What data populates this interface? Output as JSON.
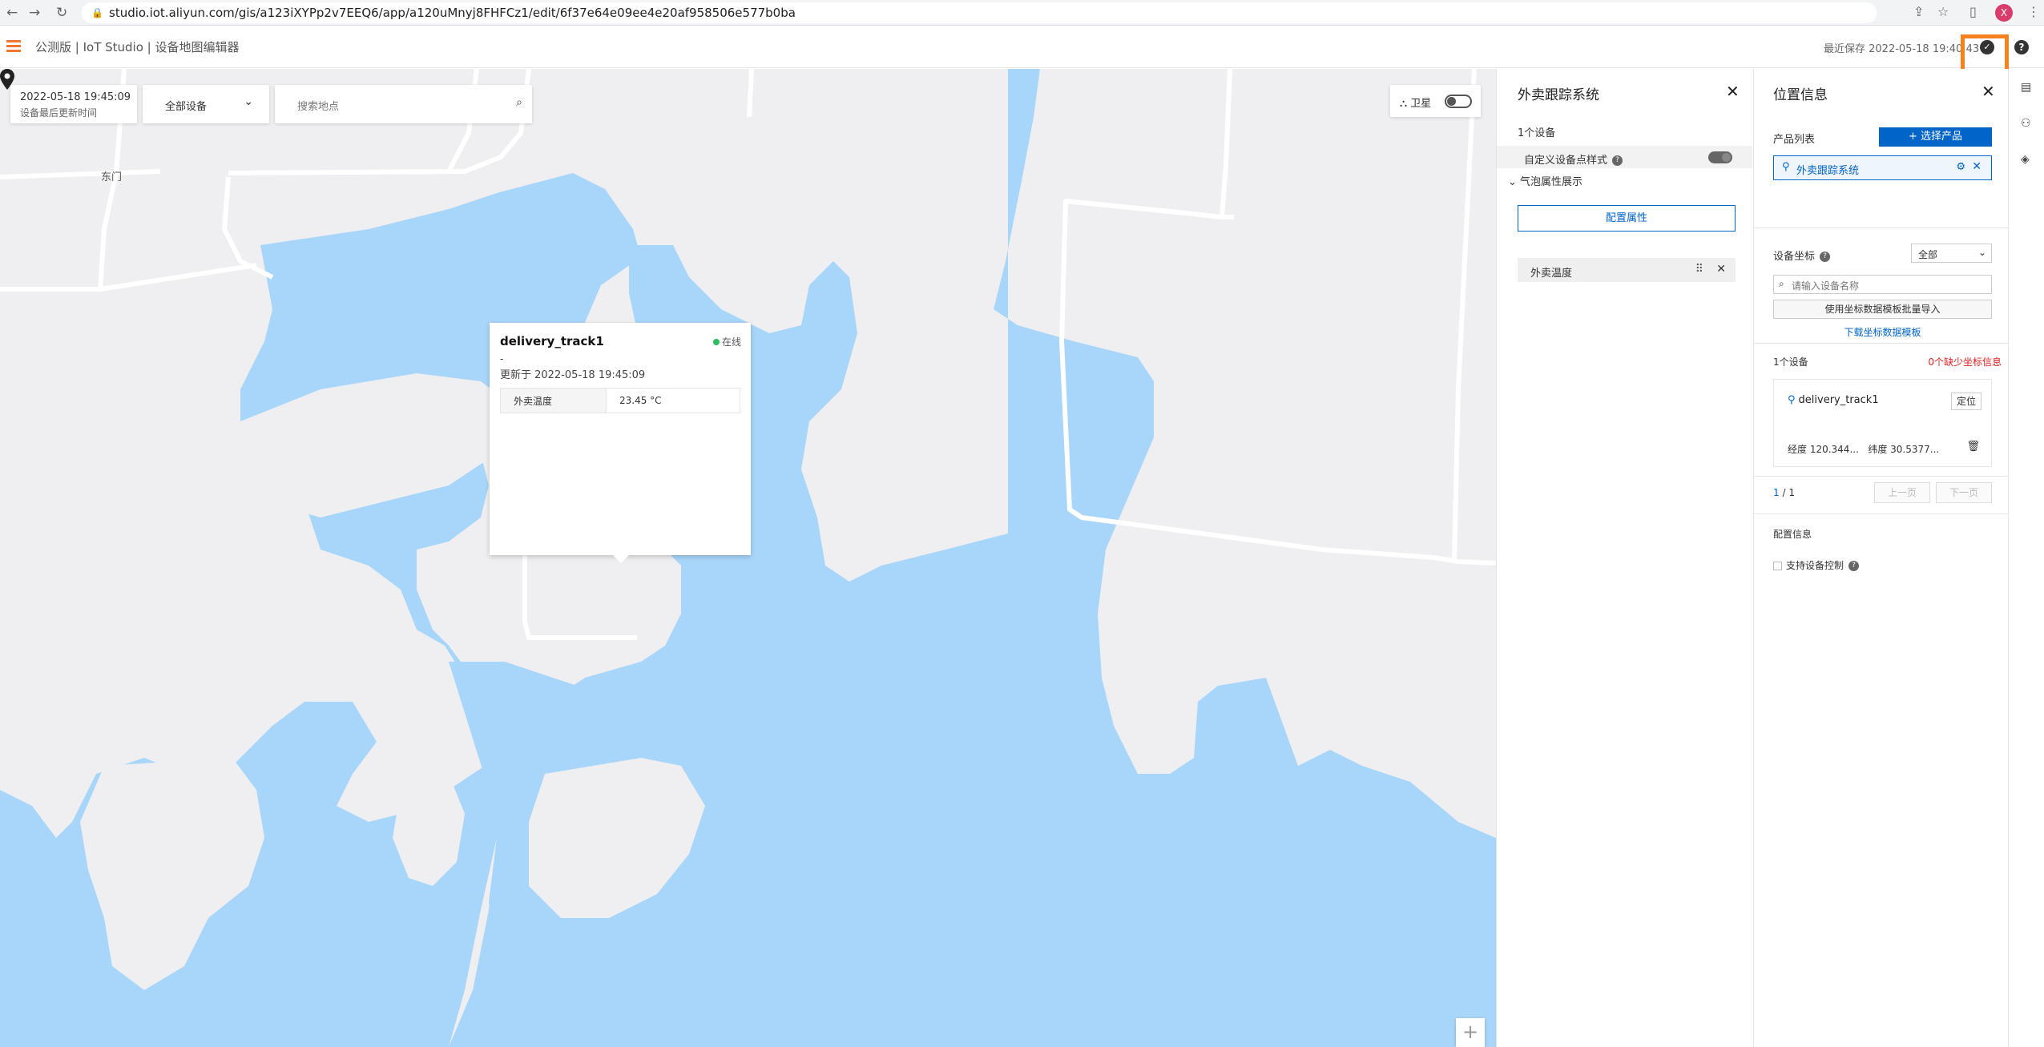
{
  "browser": {
    "url": "studio.iot.aliyun.com/gis/a123iXYPp2v7EEQ6/app/a120uMnyj8FHFCz1/edit/6f37e64e09ee4e20af958506e577b0ba",
    "profile_initial": "X"
  },
  "header": {
    "breadcrumb": "公测版 | IoT Studio | 设备地图编辑器",
    "last_saved": "最近保存 2022-05-18 19:40:43"
  },
  "map": {
    "update_time": "2022-05-18 19:45:09",
    "update_time_label": "设备最后更新时间",
    "device_filter": "全部设备",
    "search_placeholder": "搜索地点",
    "satellite_label": "卫星",
    "place_label": "东门",
    "zoom_in": "+"
  },
  "popup": {
    "device_name": "delivery_track1",
    "status": "在线",
    "dash": "-",
    "updated": "更新于 2022-05-18 19:45:09",
    "rows": [
      {
        "key": "外卖温度",
        "value": "23.45 °C"
      }
    ]
  },
  "panel_tracking": {
    "title": "外卖跟踪系统",
    "device_count": "1个设备",
    "custom_style_label": "自定义设备点样式",
    "bubble_section": "气泡属性展示",
    "config_button": "配置属性",
    "attribute_item": "外卖温度"
  },
  "panel_location": {
    "title": "位置信息",
    "product_list_label": "产品列表",
    "select_product_button": "+ 选择产品",
    "product_tag": "外卖跟踪系统",
    "coord_label": "设备坐标",
    "coord_option": "全部",
    "name_search_placeholder": "请输入设备名称",
    "import_button": "使用坐标数据模板批量导入",
    "download_link": "下载坐标数据模板",
    "device_count": "1个设备",
    "missing_info": "0个缺少坐标信息",
    "device": {
      "name": "delivery_track1",
      "locate_button": "定位",
      "longitude": "经度 120.344...",
      "latitude": "纬度 30.5377..."
    },
    "pager_current": "1",
    "pager_total": "/ 1",
    "prev_button": "上一页",
    "next_button": "下一页",
    "config_info_label": "配置信息",
    "support_control_label": "支持设备控制"
  },
  "colors": {
    "water": "#a8d6fa",
    "land": "#efeff1",
    "road": "#ffffff",
    "primary": "#0064c8",
    "highlight": "#f4821f",
    "online": "#2bbd5e",
    "menu": "#f2762e"
  },
  "icons": [
    "back-icon",
    "forward-icon",
    "reload-icon",
    "lock-icon",
    "share-icon",
    "star-icon",
    "sidebar-icon",
    "kebab-icon",
    "menu-icon",
    "check-icon",
    "help-icon",
    "chevron-down-icon",
    "search-icon",
    "satellite-icon",
    "map-pin-icon",
    "close-icon",
    "question-icon",
    "drag-icon",
    "location-icon",
    "gear-icon",
    "trash-icon",
    "layers-icon"
  ]
}
